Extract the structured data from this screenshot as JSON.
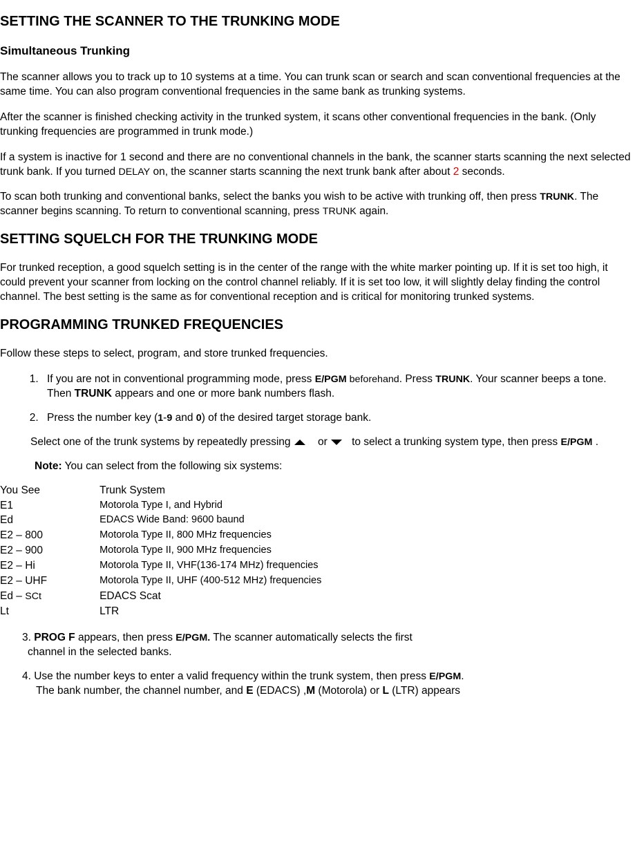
{
  "h1_1": "SETTING THE SCANNER TO THE TRUNKING MODE",
  "h2_1": "Simultaneous Trunking",
  "p1": "The scanner allows you to track up to 10 systems at a time. You can trunk scan or search and scan conventional frequencies at the same time. You can also program conventional frequencies in the same bank as trunking systems.",
  "p2": "After the scanner is finished checking activity in the trunked system,   it scans other   conventional frequencies in the bank. (Only trunking frequencies are programmed in trunk mode.)",
  "p3a": "If a system is inactive for 1 second and there are no conventional channels in the bank, the scanner starts scanning the next selected trunk bank.   If you turned ",
  "p3_delay": "DELAY",
  "p3b": " on, the scanner starts scanning the next trunk bank after about ",
  "p3_red": "2",
  "p3c": " seconds.",
  "p4a": "To scan both trunking and conventional banks, select the banks you wish to be active with trunking off, then press ",
  "p4_trunk1": "TRUNK",
  "p4b": ". The scanner begins scanning. To return to conventional scanning, press ",
  "p4_trunk2": "TRUNK",
  "p4c": " again.",
  "h1_2": "SETTING SQUELCH FOR THE TRUNKING MODE",
  "p5": "For trunked reception, a good squelch setting is in the center of the range with the white marker pointing up. If it is set too high, it could prevent your scanner from locking on the control channel reliably. If it is set too low, it will slightly delay finding the control channel. The best setting is the same as for conventional reception and is critical for monitoring trunked systems.",
  "h1_3": "PROGRAMMING TRUNKED FREQUENCIES",
  "p6": "Follow these steps to select, program, and store trunked frequencies.",
  "li1a": "If you are not in conventional programming mode, press ",
  "li1_epgm": "E/PGM",
  "li1b": " beforehand",
  "li1c": ". Press ",
  "li1_trunk": "TRUNK",
  "li1d": ". Your scanner beeps a tone. Then ",
  "li1_trunkb": "TRUNK",
  "li1e": " appears and one or more bank numbers flash.",
  "li2a": "Press the number key (",
  "li2_19": "1",
  "li2_dash": "-",
  "li2_9": "9",
  "li2b": " and ",
  "li2_0": "0",
  "li2c": ") of the desired target storage bank.",
  "sub_a": "Select one of the trunk systems by repeatedly pressing ",
  "sub_or": " or ",
  "sub_b": " to select a trunking system type, then press ",
  "sub_epgm": "E/PGM",
  "sub_c": " .",
  "note_label": "Note:",
  "note_text": " You can select from the following six systems:",
  "tbl": {
    "h1": "You See",
    "h2": "Trunk System",
    "r1c1": "E1",
    "r1c2": "Motorola Type I, and Hybrid",
    "r2c1": "Ed",
    "r2c2": "EDACS Wide Band: 9600 baund",
    "r3c1": "E2 – 800",
    "r3c2": "Motorola Type II, 800 MHz frequencies",
    "r4c1": "E2 – 900",
    "r4c2": "Motorola Type II, 900 MHz frequencies",
    "r5c1": "E2 – Hi",
    "r5c2": "Motorola Type II, VHF(136-174 MHz) frequencies",
    "r6c1": "E2 – UHF",
    "r6c2": "Motorola Type II, UHF (400-512 MHz) frequencies",
    "r7c1a": "Ed – ",
    "r7c1b": "SCt",
    "r7c2": "EDACS Scat",
    "r8c1": "Lt",
    "r8c2": " LTR"
  },
  "s3a": "3. ",
  "s3_prog": "PROG F",
  "s3b": " appears, then press ",
  "s3_epgm": "E/PGM.",
  "s3c": " The scanner automatically selects the first",
  "s3d": "channel in the selected banks.",
  "s4a": "4. Use the number keys to enter a valid frequency within the trunk system, then press ",
  "s4_epgm": "E/PGM",
  "s4b": ".",
  "s4c": "The bank number, the channel number, and ",
  "s4_E": "E",
  "s4d": " (EDACS) ,",
  "s4_M": "M",
  "s4e": " (Motorola) or ",
  "s4_L": "L",
  "s4f": " (LTR) appears"
}
